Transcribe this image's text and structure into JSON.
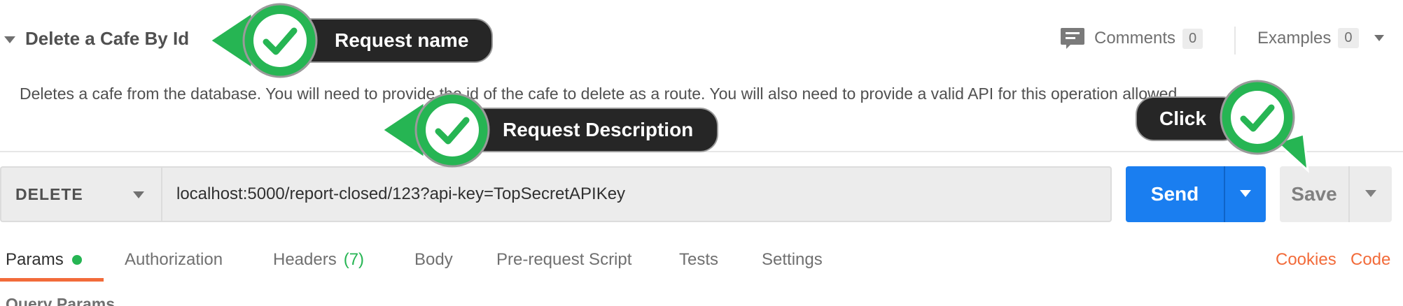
{
  "request": {
    "name": "Delete a Cafe By Id",
    "description": "Deletes a cafe from the database. You will need to provide the id of the cafe to delete as a route. You will also need to provide a valid API for this operation allowed."
  },
  "header": {
    "comments_label": "Comments",
    "comments_count": "0",
    "examples_label": "Examples",
    "examples_count": "0"
  },
  "url_bar": {
    "method": "DELETE",
    "url": "localhost:5000/report-closed/123?api-key=TopSecretAPIKey",
    "send_label": "Send",
    "save_label": "Save"
  },
  "tabs": [
    {
      "label": "Params",
      "active": true
    },
    {
      "label": "Authorization"
    },
    {
      "label": "Headers",
      "count": "(7)"
    },
    {
      "label": "Body"
    },
    {
      "label": "Pre-request Script"
    },
    {
      "label": "Tests"
    },
    {
      "label": "Settings"
    }
  ],
  "links": {
    "cookies": "Cookies",
    "code": "Code"
  },
  "section": {
    "query_params": "Query Params"
  },
  "annotations": {
    "request_name": "Request name",
    "request_description": "Request Description",
    "click": "Click"
  },
  "colors": {
    "send_blue": "#1a7ef0",
    "accent_orange": "#f26b3a",
    "check_green": "#26b553",
    "callout_dark": "#262626"
  }
}
